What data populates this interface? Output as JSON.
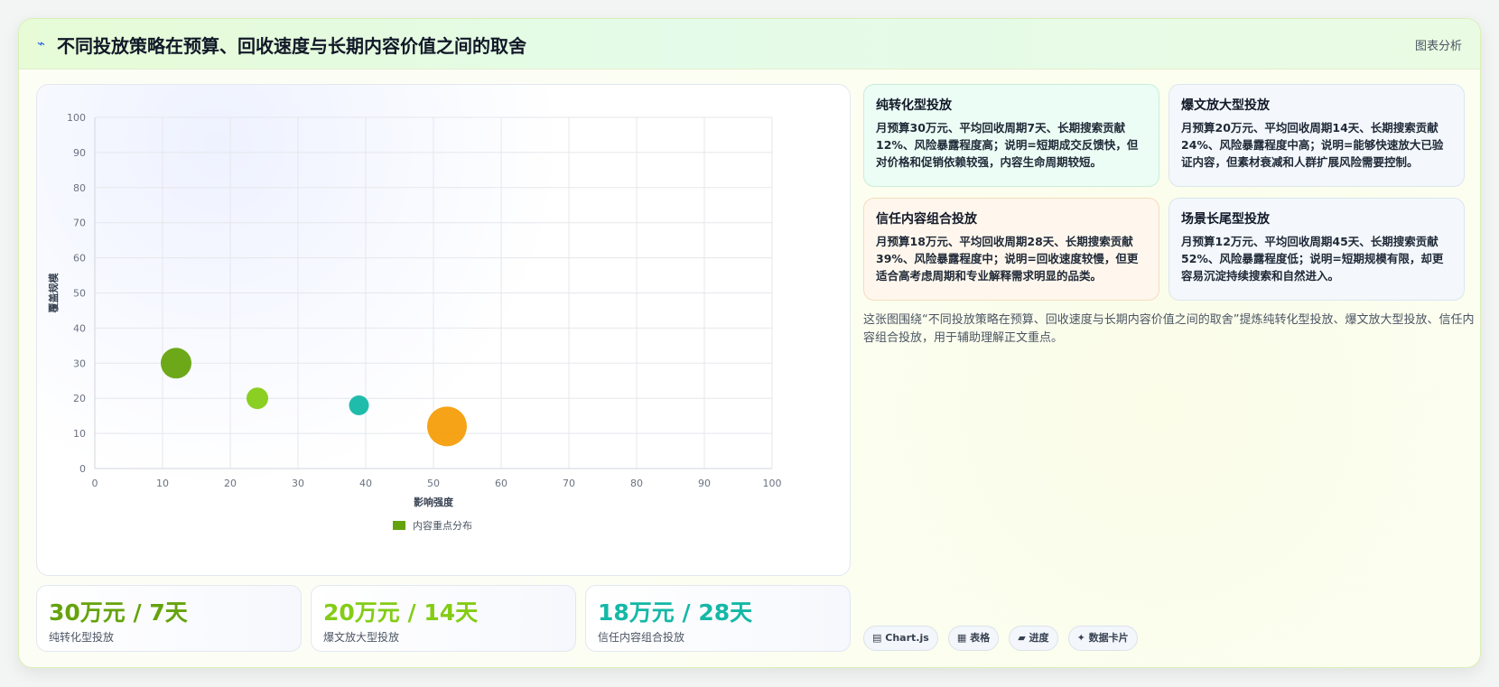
{
  "header": {
    "icon": "lightning-icon",
    "title": "不同投放策略在预算、回收速度与长期内容价值之间的取舍",
    "tag": "图表分析"
  },
  "chart_data": {
    "type": "scatter",
    "xlabel": "影响强度",
    "ylabel": "覆盖规模",
    "xlim": [
      0,
      100
    ],
    "ylim": [
      0,
      100
    ],
    "xticks": [
      0,
      10,
      20,
      30,
      40,
      50,
      60,
      70,
      80,
      90,
      100
    ],
    "yticks": [
      0,
      10,
      20,
      30,
      40,
      50,
      60,
      70,
      80,
      90,
      100
    ],
    "grid": true,
    "legend_position": "bottom",
    "series": [
      {
        "name": "内容重点分布",
        "points": [
          {
            "x": 12,
            "y": 30,
            "r": 30,
            "color": "#65a30d"
          },
          {
            "x": 24,
            "y": 20,
            "r": 20,
            "color": "#84cc16"
          },
          {
            "x": 39,
            "y": 18,
            "r": 18,
            "color": "#14b8a6"
          },
          {
            "x": 52,
            "y": 12,
            "r": 40,
            "color": "#f59e0b"
          }
        ]
      }
    ]
  },
  "stats": [
    {
      "value": "30万元 / 7天",
      "label": "纯转化型投放",
      "color": "#65a30d"
    },
    {
      "value": "20万元 / 14天",
      "label": "爆文放大型投放",
      "color": "#84cc16"
    },
    {
      "value": "18万元 / 28天",
      "label": "信任内容组合投放",
      "color": "#14b8a6"
    }
  ],
  "cards": [
    {
      "title": "纯转化型投放",
      "body": "月预算30万元、平均回收周期7天、长期搜索贡献12%、风险暴露程度高；说明=短期成交反馈快，但对价格和促销依赖较强，内容生命周期较短。",
      "bg": "#ecfdf5",
      "border": "#c9eedb"
    },
    {
      "title": "爆文放大型投放",
      "body": "月预算20万元、平均回收周期14天、长期搜索贡献24%、风险暴露程度中高；说明=能够快速放大已验证内容，但素材衰减和人群扩展风险需要控制。",
      "bg": "#f4f8fc",
      "border": "#dbe6ef"
    },
    {
      "title": "信任内容组合投放",
      "body": "月预算18万元、平均回收周期28天、长期搜索贡献39%、风险暴露程度中；说明=回收速度较慢，但更适合高考虑周期和专业解释需求明显的品类。",
      "bg": "#fff7ed",
      "border": "#f5dcbc"
    },
    {
      "title": "场景长尾型投放",
      "body": "月预算12万元、平均回收周期45天、长期搜索贡献52%、风险暴露程度低；说明=短期规模有限，却更容易沉淀持续搜索和自然进入。",
      "bg": "#f4f8fc",
      "border": "#dbe6ef"
    }
  ],
  "summary": "这张图围绕“不同投放策略在预算、回收速度与长期内容价值之间的取舍”提炼纯转化型投放、爆文放大型投放、信任内容组合投放，用于辅助理解正文重点。",
  "pills": [
    {
      "icon": "chart-icon",
      "glyph": "▤",
      "label": "Chart.js"
    },
    {
      "icon": "table-icon",
      "glyph": "▦",
      "label": "表格"
    },
    {
      "icon": "progress-icon",
      "glyph": "▰",
      "label": "进度"
    },
    {
      "icon": "sparkle-icon",
      "glyph": "✦",
      "label": "数据卡片"
    }
  ]
}
